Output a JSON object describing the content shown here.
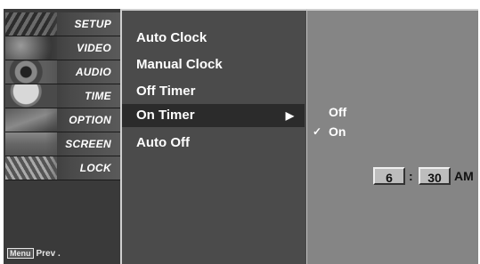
{
  "sidebar": {
    "categories": [
      {
        "label": "SETUP"
      },
      {
        "label": "VIDEO"
      },
      {
        "label": "AUDIO"
      },
      {
        "label": "TIME"
      },
      {
        "label": "OPTION"
      },
      {
        "label": "SCREEN"
      },
      {
        "label": "LOCK"
      }
    ],
    "footer": {
      "key": "Menu",
      "text": "Prev ."
    }
  },
  "menu": {
    "items": [
      {
        "label": "Auto Clock"
      },
      {
        "label": "Manual Clock"
      },
      {
        "label": "Off Timer"
      },
      {
        "label": "On Timer",
        "arrow": "▶"
      },
      {
        "label": "Auto Off"
      }
    ],
    "selected": "On Timer"
  },
  "submenu": {
    "options": [
      {
        "label": "Off"
      },
      {
        "label": "On",
        "check": "✓"
      }
    ],
    "time": {
      "hour": "6",
      "separator": ":",
      "minute": "30",
      "ampm": "AM"
    }
  }
}
